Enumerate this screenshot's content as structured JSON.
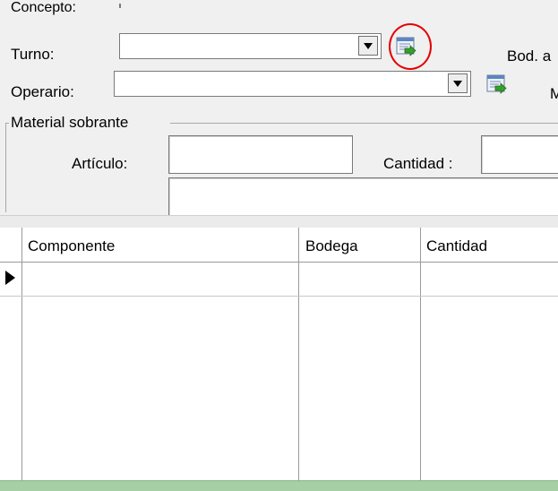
{
  "form": {
    "concepto_label": "Concepto:",
    "turno_label": "Turno:",
    "turno_value": "",
    "bod_label": "Bod. a",
    "operario_label": "Operario:",
    "operario_value": "",
    "m_label": "M",
    "material_group_label": "Material sobrante",
    "articulo_label": "Artículo:",
    "articulo_value": "",
    "cantidad_label": "Cantidad :",
    "cantidad_value": "",
    "descripcion_value": ""
  },
  "grid": {
    "columns": [
      "Componente",
      "Bodega",
      "Cantidad"
    ],
    "rows": [
      {
        "componente": "",
        "bodega": "",
        "cantidad": ""
      }
    ]
  },
  "icons": {
    "turno_lookup": "lookup-arrow-icon",
    "operario_lookup": "lookup-arrow-icon",
    "dropdown": "chevron-down-icon",
    "row_indicator": "current-row-arrow-icon"
  },
  "colors": {
    "annotation_circle": "#e50000",
    "footer_row": "#a7cfa5",
    "panel_bg": "#f0f0f0"
  }
}
